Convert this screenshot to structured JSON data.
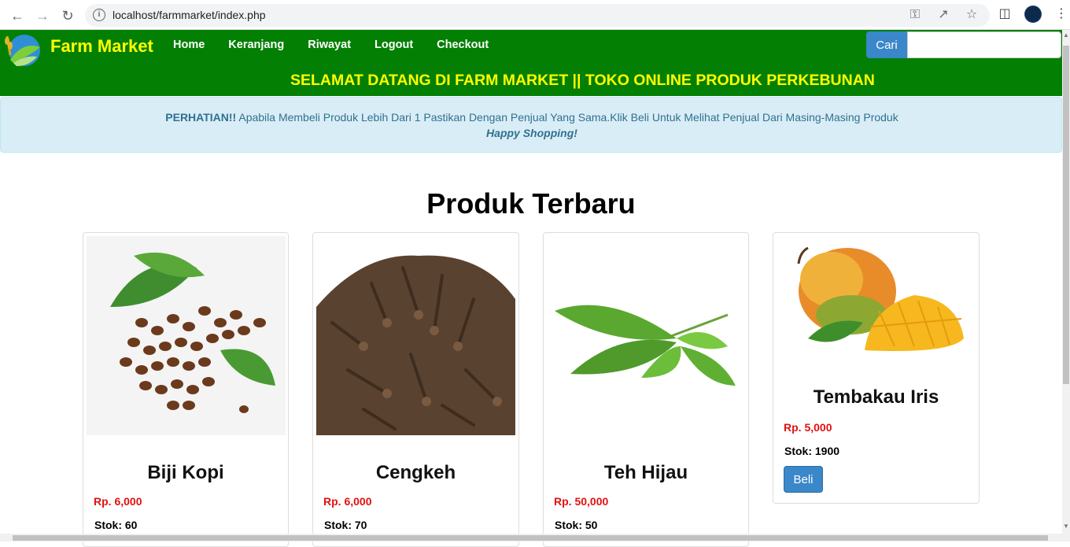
{
  "browser": {
    "url": "localhost/farmmarket/index.php"
  },
  "navbar": {
    "brand": "Farm Market",
    "links": [
      "Home",
      "Keranjang",
      "Riwayat",
      "Logout",
      "Checkout"
    ],
    "search_button": "Cari",
    "search_placeholder": "",
    "welcome": "SELAMAT DATANG DI FARM MARKET || TOKO ONLINE PRODUK PERKEBUNAN"
  },
  "alert": {
    "strong": "PERHATIAN!!",
    "text": " Apabila Membeli Produk Lebih Dari 1 Pastikan Dengan Penjual Yang Sama.Klik Beli Untuk Melihat Penjual Dari Masing-Masing Produk",
    "tagline": "Happy Shopping!"
  },
  "main": {
    "title": "Produk Terbaru",
    "products": [
      {
        "name": "Biji Kopi",
        "price": "Rp. 6,000",
        "stock": "Stok: 60",
        "image": "coffee-beans"
      },
      {
        "name": "Cengkeh",
        "price": "Rp. 6,000",
        "stock": "Stok: 70",
        "image": "cloves"
      },
      {
        "name": "Teh Hijau",
        "price": "Rp. 50,000",
        "stock": "Stok: 50",
        "image": "tea-leaves"
      },
      {
        "name": "Tembakau Iris",
        "price": "Rp. 5,000",
        "stock": "Stok: 1900",
        "image": "mango",
        "buy_label": "Beli"
      }
    ]
  }
}
